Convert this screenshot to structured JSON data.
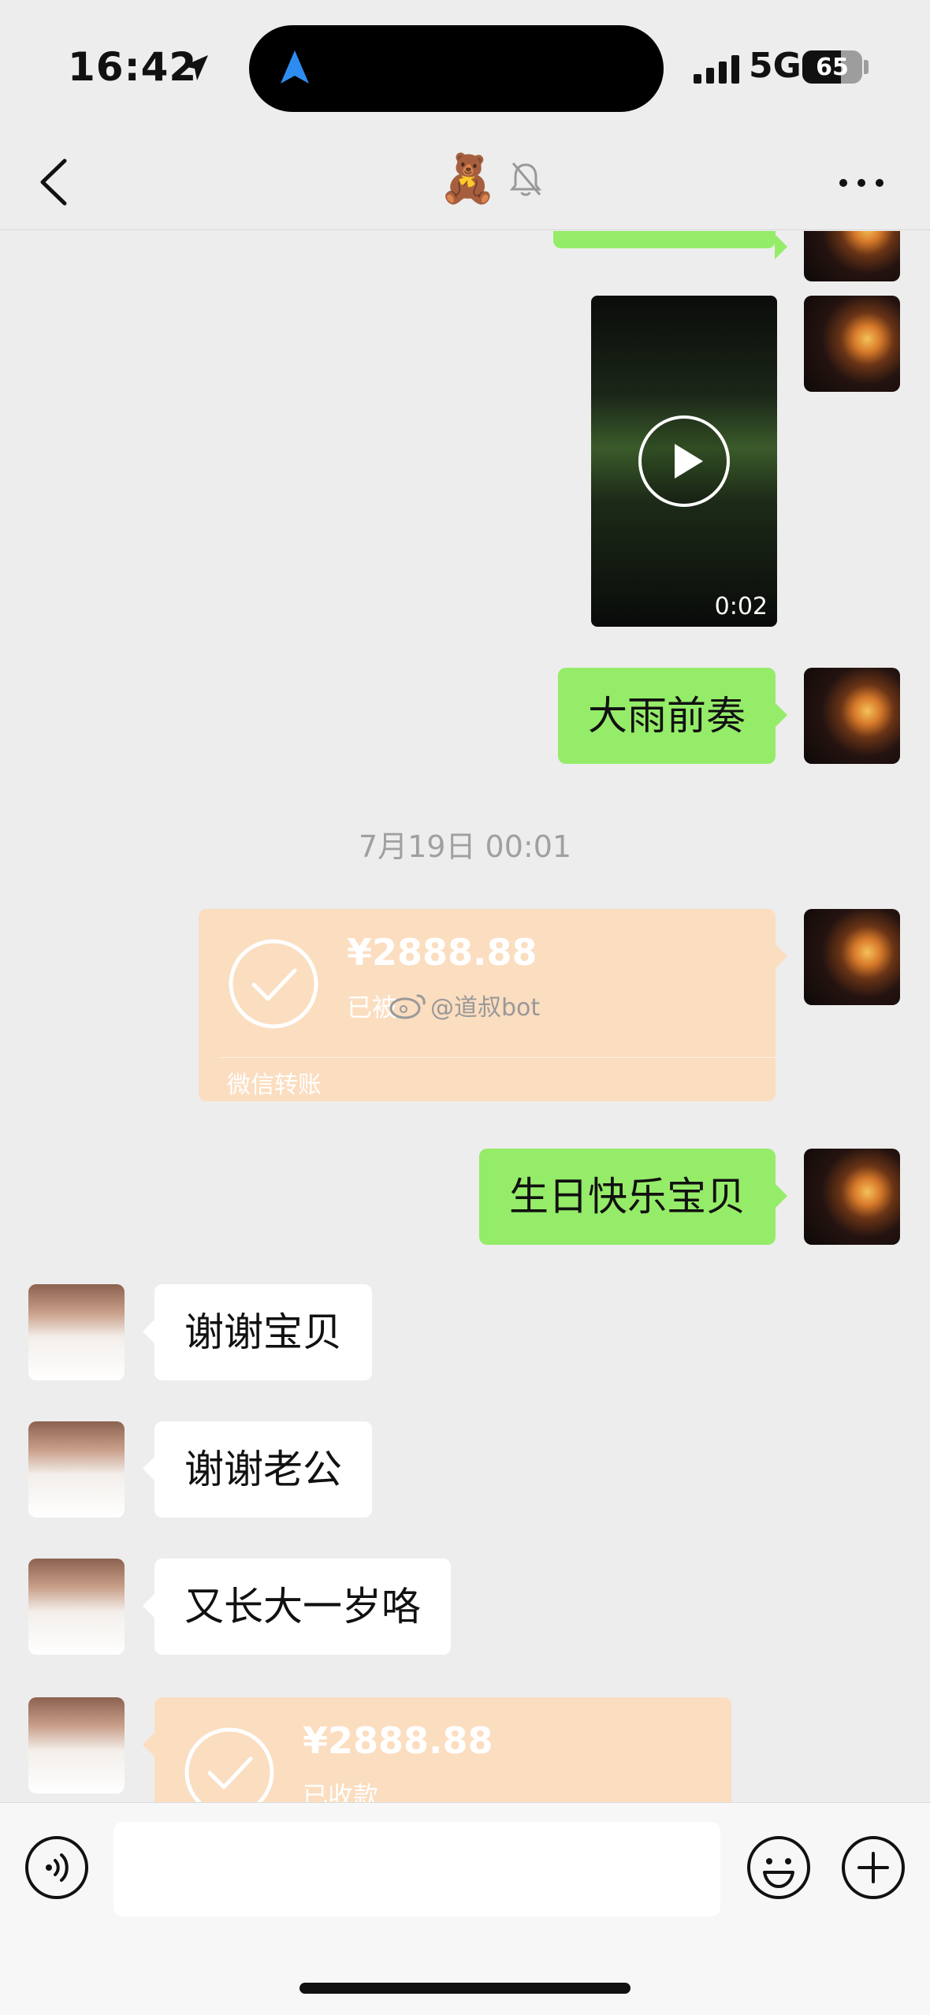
{
  "status_bar": {
    "time": "16:42",
    "network": "5G",
    "battery": "65",
    "battery_level": 0.65
  },
  "nav": {
    "title": "🧸"
  },
  "icons": {
    "location": "location-arrow-icon",
    "dynamic_island_nav": "navigation-icon",
    "signal": "signal-icon",
    "back": "chevron-left-icon",
    "mute": "bell-slash-icon",
    "more": "ellipsis-icon",
    "play": "play-icon",
    "check": "check-circle-icon",
    "voice": "voice-icon",
    "emoji": "smile-icon",
    "plus": "plus-circle-icon",
    "weibo": "weibo-icon"
  },
  "colors": {
    "my_bubble": "#95ec69",
    "their_bubble": "#ffffff",
    "transfer": "#fbddc0",
    "background": "#ededed"
  },
  "messages": {
    "video": {
      "duration": "0:02"
    },
    "m1": "大雨前奏",
    "timestamp": "7月19日 00:01",
    "transfer_sent": {
      "amount": "¥2888.88",
      "status": "已被",
      "label": "微信转账"
    },
    "m2": "生日快乐宝贝",
    "r1": "谢谢宝贝",
    "r2": "谢谢老公",
    "r3": "又长大一岁咯",
    "transfer_received": {
      "amount": "¥2888.88",
      "status": "已收款"
    }
  },
  "watermark": {
    "text": "@道叔bot"
  },
  "input": {
    "value": ""
  }
}
